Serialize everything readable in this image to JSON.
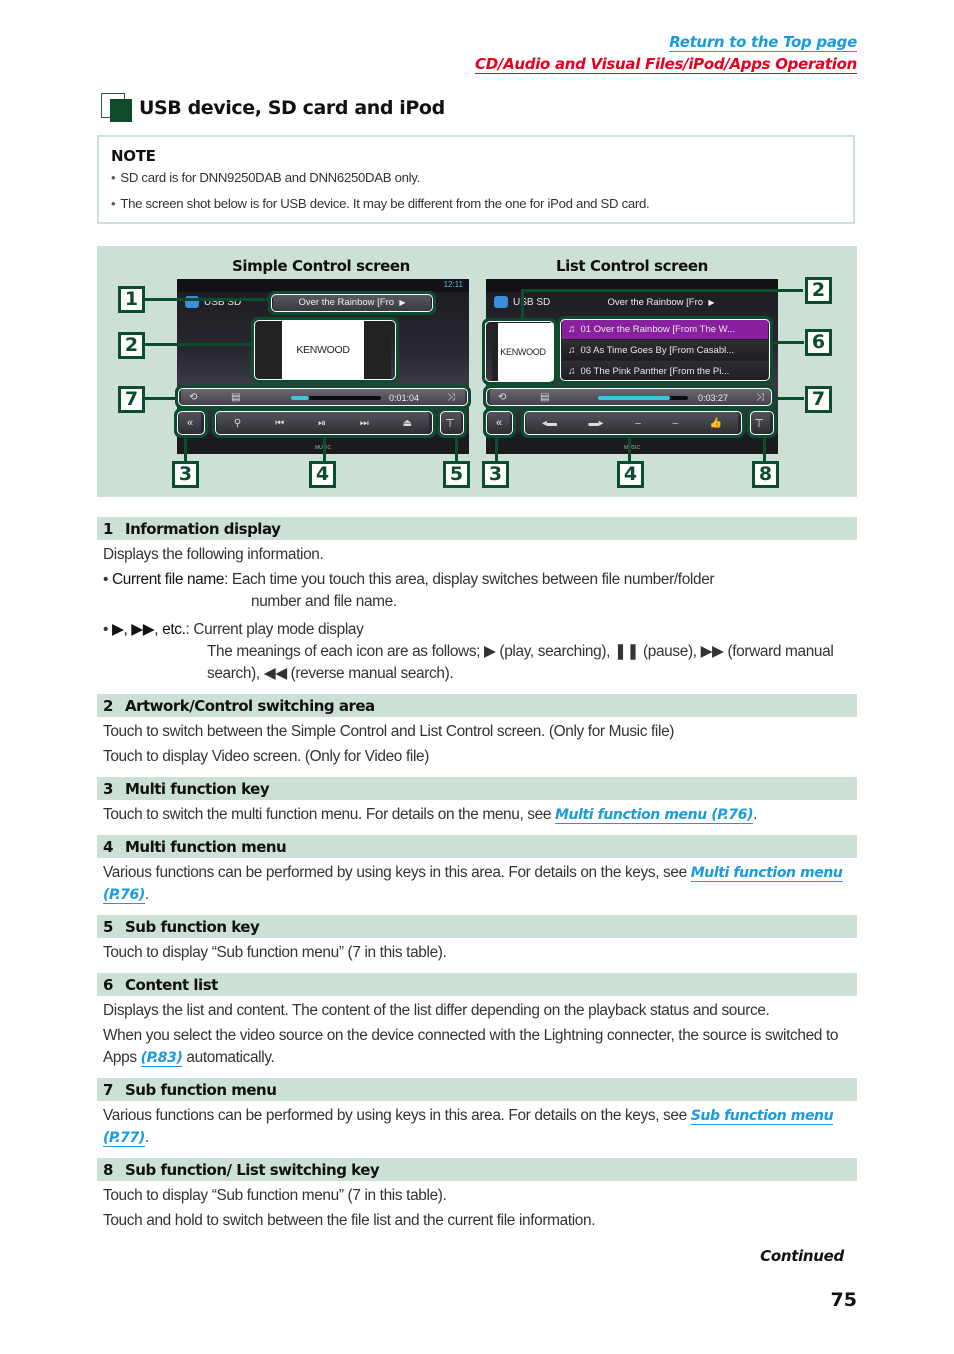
{
  "nav": {
    "top_link": "Return to the Top page",
    "section_link": "CD/Audio and Visual Files/iPod/Apps Operation",
    "colors": {
      "top_link": "#1a9be0",
      "section_link": "#e5001f"
    }
  },
  "section": {
    "title": "USB device, SD card and iPod",
    "icon": "section-square-icon"
  },
  "note": {
    "heading": "NOTE",
    "items": [
      "SD card is for DNN9250DAB and DNN6250DAB only.",
      "The screen shot below is for USB device. It may be different from the one for iPod and SD card."
    ]
  },
  "figure": {
    "simple": {
      "label": "Simple Control screen",
      "clock": "12:11",
      "source": "USB SD",
      "track_title": "Over the Rainbow [Fro",
      "play_mode_icon": "▶",
      "artwork_brand": "KENWOOD",
      "time": "0:01:04",
      "progress_fraction": 0.2,
      "multi_keys": [
        "search-icon",
        "prev-track-icon",
        "play-pause-icon",
        "next-track-icon",
        "eject-icon"
      ],
      "bottom_label": "MUSIC",
      "callouts": [
        "1",
        "2",
        "7",
        "3",
        "4",
        "5"
      ]
    },
    "list": {
      "label": "List Control screen",
      "source": "USB SD",
      "track_title": "Over the Rainbow [Fro",
      "play_mode_icon": "▶",
      "artwork_brand": "KENWOOD",
      "time": "0:03:27",
      "progress_fraction": 0.8,
      "list_items": [
        "01 Over the Rainbow [From The W...",
        "03 As Time Goes By [From Casabl...",
        "06 The Pink Panther [From the Pi..."
      ],
      "multi_keys": [
        "folder-prev-icon",
        "folder-next-icon",
        "dash-icon",
        "dash-icon",
        "thumb-up-icon"
      ],
      "bottom_label": "MUSIC",
      "callouts": [
        "2",
        "6",
        "7",
        "3",
        "4",
        "8"
      ]
    }
  },
  "items": [
    {
      "num": "1",
      "title": "Information display",
      "intro": "Displays the following information.",
      "bullets": [
        {
          "term": "Current file name",
          "text": ": Each time you touch this area, display switches between file number/folder",
          "cont": "number and file name."
        },
        {
          "term": "▶, ▶▶, etc.",
          "text": ": Current play mode display",
          "cont": "The meanings of each icon are as follows; ▶ (play, searching), ❚❚ (pause), ▶▶ (forward manual search), ◀◀ (reverse manual search)."
        }
      ]
    },
    {
      "num": "2",
      "title": "Artwork/Control switching area",
      "lines": [
        "Touch to switch between the Simple Control and List Control screen. (Only for Music file)",
        "Touch to display Video screen. (Only for Video file)"
      ]
    },
    {
      "num": "3",
      "title": "Multi function key",
      "pre": "Touch to switch the multi function menu. For details on the menu, see ",
      "link": "Multi function menu (P.76)",
      "post": "."
    },
    {
      "num": "4",
      "title": "Multi function menu",
      "pre": "Various functions can be performed by using keys in this area. For details on the keys, see ",
      "link": "Multi function menu (P.76)",
      "post": "."
    },
    {
      "num": "5",
      "title": "Sub function key",
      "lines": [
        "Touch to display “Sub function menu” (7 in this table)."
      ]
    },
    {
      "num": "6",
      "title": "Content list",
      "lines": [
        "Displays the list and content. The content of the list differ depending on the playback status and source."
      ],
      "pre": "When you select the video source on the device connected with the Lightning connecter, the source is switched to Apps ",
      "link": "(P.83)",
      "post": " automatically."
    },
    {
      "num": "7",
      "title": "Sub function menu",
      "pre": "Various functions can be performed by using keys in this area. For details on the keys, see ",
      "link": "Sub function menu (P.77)",
      "post": "."
    },
    {
      "num": "8",
      "title": "Sub function/ List switching key",
      "lines": [
        "Touch to display “Sub function menu” (7 in this table).",
        "Touch and hold to switch between the file list and the current file information."
      ]
    }
  ],
  "footer": {
    "continued": "Continued",
    "page_number": "75"
  }
}
